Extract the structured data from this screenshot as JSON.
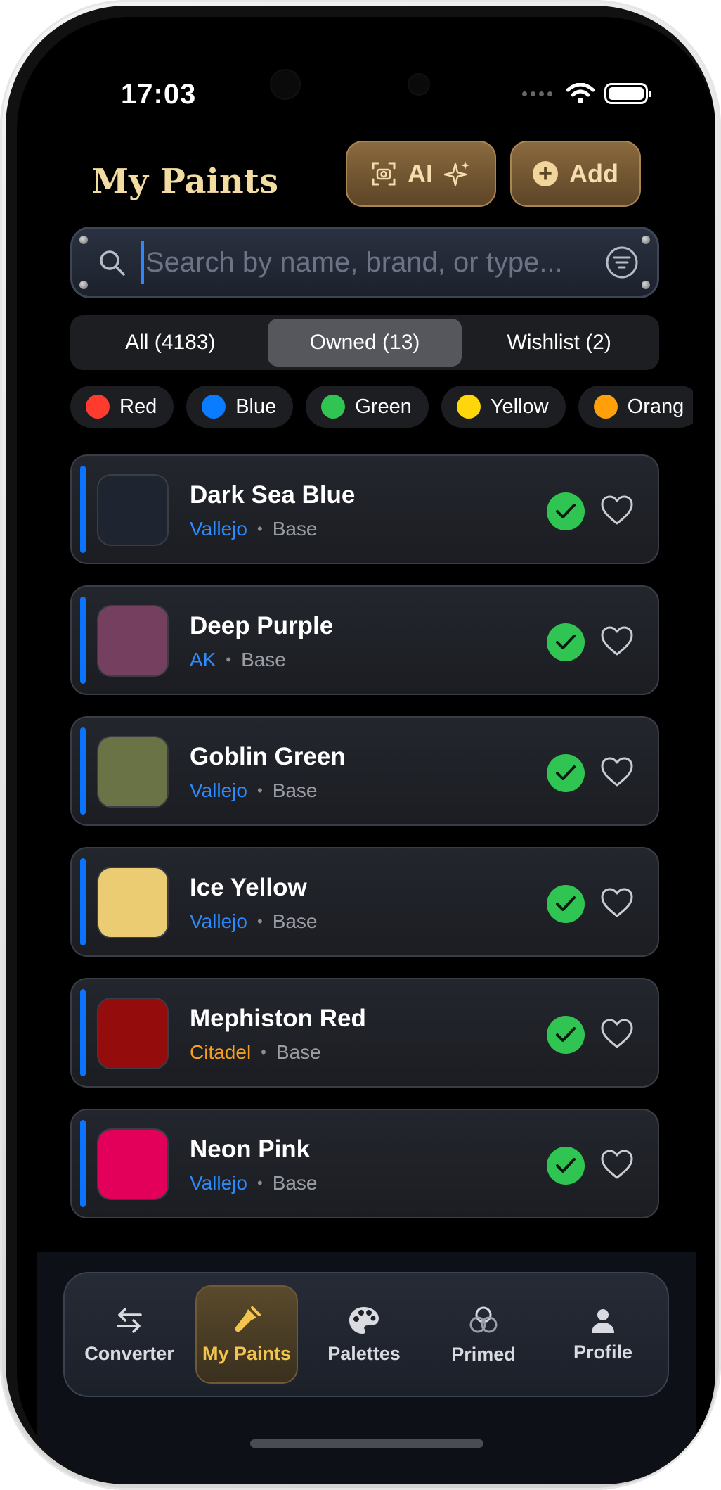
{
  "status_bar": {
    "time": "17:03"
  },
  "header": {
    "title": "My Paints",
    "ai_button": "AI",
    "add_button": "Add"
  },
  "search": {
    "placeholder": "Search by name, brand, or type..."
  },
  "segments": [
    {
      "label": "All (4183)",
      "active": false
    },
    {
      "label": "Owned (13)",
      "active": true
    },
    {
      "label": "Wishlist (2)",
      "active": false
    }
  ],
  "color_filters": [
    {
      "label": "Red",
      "color": "#ff3b30"
    },
    {
      "label": "Blue",
      "color": "#0a7cff"
    },
    {
      "label": "Green",
      "color": "#30c552"
    },
    {
      "label": "Yellow",
      "color": "#ffd60a"
    },
    {
      "label": "Orang",
      "color": "#ff9f0a"
    }
  ],
  "paints": [
    {
      "name": "Dark Sea Blue",
      "brand": "Vallejo",
      "type": "Base",
      "swatch": "#1f2530",
      "brand_color": "#2b8bff",
      "owned": true
    },
    {
      "name": "Deep Purple",
      "brand": "AK",
      "type": "Base",
      "swatch": "#75405f",
      "brand_color": "#2b8bff",
      "owned": true
    },
    {
      "name": "Goblin Green",
      "brand": "Vallejo",
      "type": "Base",
      "swatch": "#6a7345",
      "brand_color": "#2b8bff",
      "owned": true
    },
    {
      "name": "Ice Yellow",
      "brand": "Vallejo",
      "type": "Base",
      "swatch": "#eccc73",
      "brand_color": "#2b8bff",
      "owned": true
    },
    {
      "name": "Mephiston Red",
      "brand": "Citadel",
      "type": "Base",
      "swatch": "#940c0c",
      "brand_color": "#f59e1f",
      "owned": true
    },
    {
      "name": "Neon Pink",
      "brand": "Vallejo",
      "type": "Base",
      "swatch": "#e2005a",
      "brand_color": "#2b8bff",
      "owned": true
    }
  ],
  "tabs": [
    {
      "label": "Converter",
      "icon": "arrows-swap-icon",
      "active": false
    },
    {
      "label": "My Paints",
      "icon": "paintbrush-icon",
      "active": true
    },
    {
      "label": "Palettes",
      "icon": "palette-icon",
      "active": false
    },
    {
      "label": "Primed",
      "icon": "overlapping-circles-icon",
      "active": false
    },
    {
      "label": "Profile",
      "icon": "person-icon",
      "active": false
    }
  ]
}
